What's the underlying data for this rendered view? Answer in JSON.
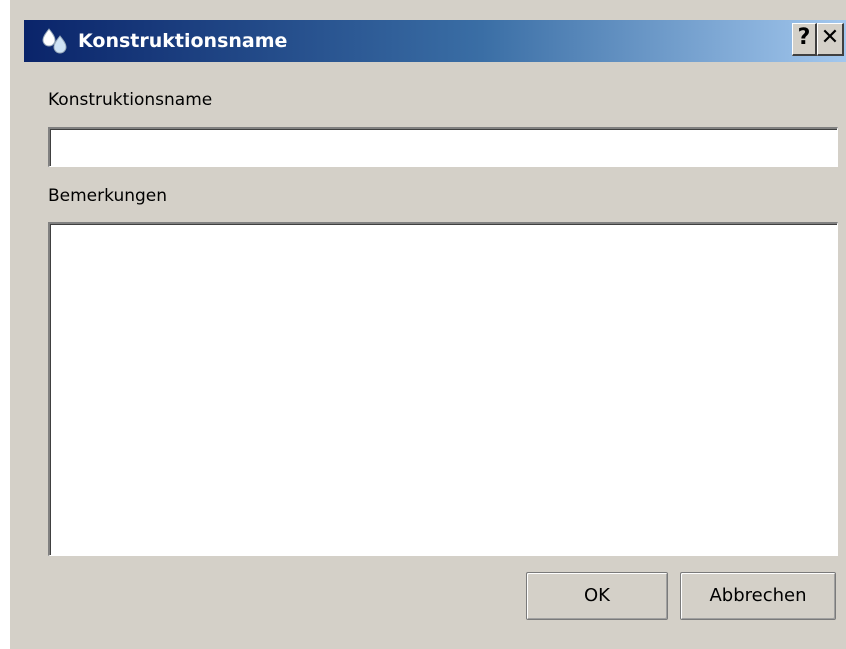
{
  "dialog": {
    "title": "Konstruktionsname",
    "help_label": "?",
    "close_label": "✕",
    "icon": "drop-icon"
  },
  "form": {
    "name_label": "Konstruktionsname",
    "name_value": "",
    "remarks_label": "Bemerkungen",
    "remarks_value": ""
  },
  "buttons": {
    "ok_label": "OK",
    "cancel_label": "Abbrechen"
  },
  "colors": {
    "titlebar_start": "#0a246a",
    "titlebar_end": "#a6caf0",
    "dialog_bg": "#d4d0c8"
  }
}
